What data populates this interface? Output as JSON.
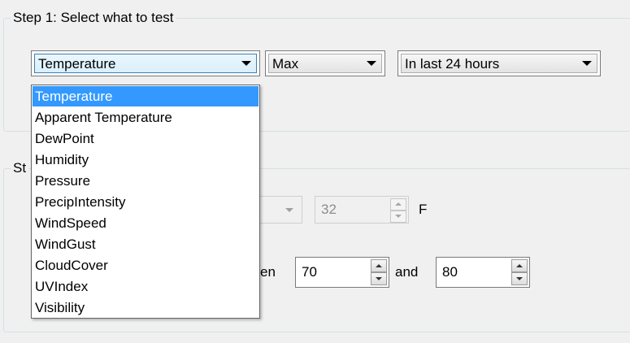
{
  "step1": {
    "title": "Step 1: Select what to test",
    "field_combo": "Temperature",
    "aggregate_combo": "Max",
    "period_combo": "In last 24 hours"
  },
  "step2": {
    "title_partial": "St"
  },
  "row1": {
    "value": "32",
    "unit": "F"
  },
  "row2": {
    "between_partial": "en",
    "min_value": "70",
    "and_label": "and",
    "max_value": "80"
  },
  "dropdown": {
    "items": [
      "Temperature",
      "Apparent Temperature",
      "DewPoint",
      "Humidity",
      "Pressure",
      "PrecipIntensity",
      "WindSpeed",
      "WindGust",
      "CloudCover",
      "UVIndex",
      "Visibility"
    ],
    "selected_index": 0
  }
}
